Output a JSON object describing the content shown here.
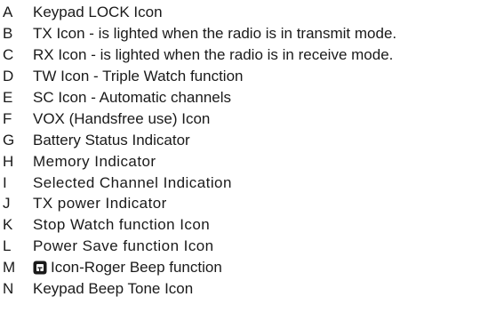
{
  "legend": {
    "items": [
      {
        "letter": "A",
        "text": "Keypad LOCK Icon"
      },
      {
        "letter": "B",
        "text": "TX Icon - is lighted when the radio is in transmit mode."
      },
      {
        "letter": "C",
        "text": "RX Icon - is lighted when the radio is in receive mode."
      },
      {
        "letter": "D",
        "text": "TW Icon - Triple Watch function"
      },
      {
        "letter": "E",
        "text": "SC Icon - Automatic channels"
      },
      {
        "letter": "F",
        "text": "VOX (Handsfree use) Icon"
      },
      {
        "letter": "G",
        "text": "Battery Status Indicator"
      },
      {
        "letter": "H",
        "text": "Memory Indicator"
      },
      {
        "letter": "I",
        "text": "Selected Channel Indication"
      },
      {
        "letter": "J",
        "text": "TX power Indicator"
      },
      {
        "letter": "K",
        "text": "Stop Watch function Icon"
      },
      {
        "letter": "L",
        "text": "Power Save function Icon"
      },
      {
        "letter": "M",
        "text": "Icon-Roger Beep function",
        "icon": "roger-beep-icon"
      },
      {
        "letter": "N",
        "text": "Keypad Beep Tone Icon"
      }
    ]
  }
}
